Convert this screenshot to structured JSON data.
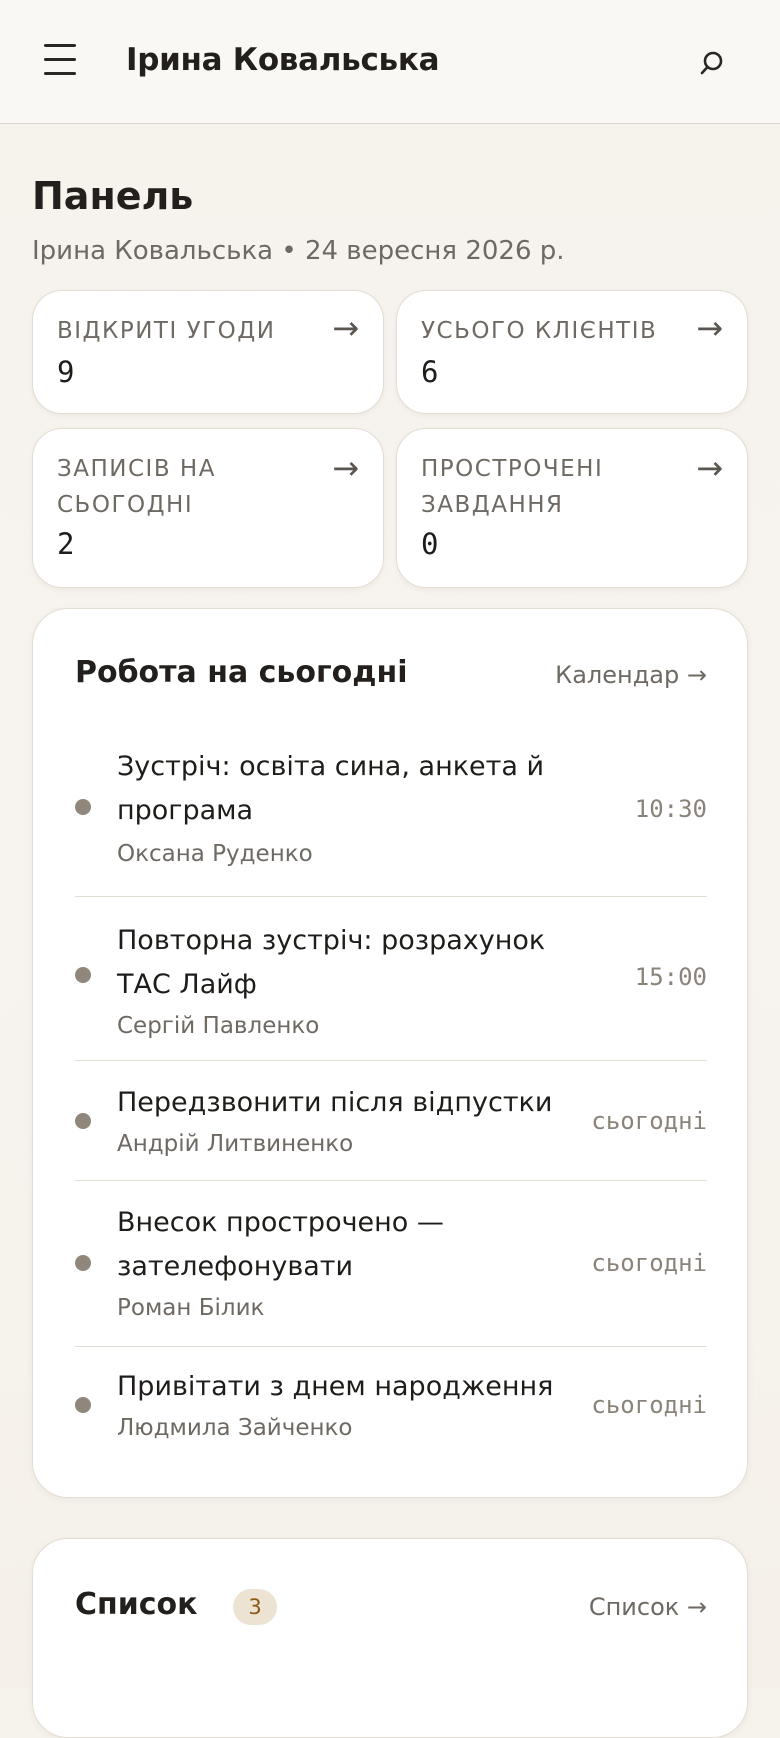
{
  "header": {
    "title": "Ірина Ковальська",
    "menu_icon": "hamburger-menu-icon",
    "search_icon": "search-icon"
  },
  "page": {
    "title": "Панель",
    "subtitle": "Ірина Ковальська • 24 вересня 2026 р."
  },
  "stats": [
    {
      "label": "ВІДКРИТІ УГОДИ",
      "value": "9",
      "arrow": "→"
    },
    {
      "label": "УСЬОГО КЛІЄНТІВ",
      "value": "6",
      "arrow": "→"
    },
    {
      "label": "ЗАПИСІВ НА СЬОГОДНІ",
      "value": "2",
      "arrow": "→"
    },
    {
      "label": "ПРОСТРОЧЕНІ ЗАВДАННЯ",
      "value": "0",
      "arrow": "→"
    }
  ],
  "today": {
    "title": "Робота на сьогодні",
    "link": "Календар →",
    "items": [
      {
        "title": "Зустріч: освіта сина, анкета й програма",
        "client": "Оксана Руденко",
        "time": "10:30"
      },
      {
        "title": "Повторна зустріч: розрахунок ТАС Лайф",
        "client": "Сергій Павленко",
        "time": "15:00"
      },
      {
        "title": "Передзвонити після відпустки",
        "client": "Андрій Литвиненко",
        "time": "сьогодні"
      },
      {
        "title": "Внесок прострочено — зателефонувати",
        "client": "Роман Білик",
        "time": "сьогодні"
      },
      {
        "title": "Привітати з днем народження",
        "client": "Людмила Зайченко",
        "time": "сьогодні"
      }
    ]
  },
  "list_card": {
    "title": "Список",
    "count": "3",
    "link": "Список →"
  },
  "colors": {
    "accent_badge_bg": "#ece3d3",
    "accent_badge_text": "#8a5a12",
    "dot": "#8f877b"
  }
}
